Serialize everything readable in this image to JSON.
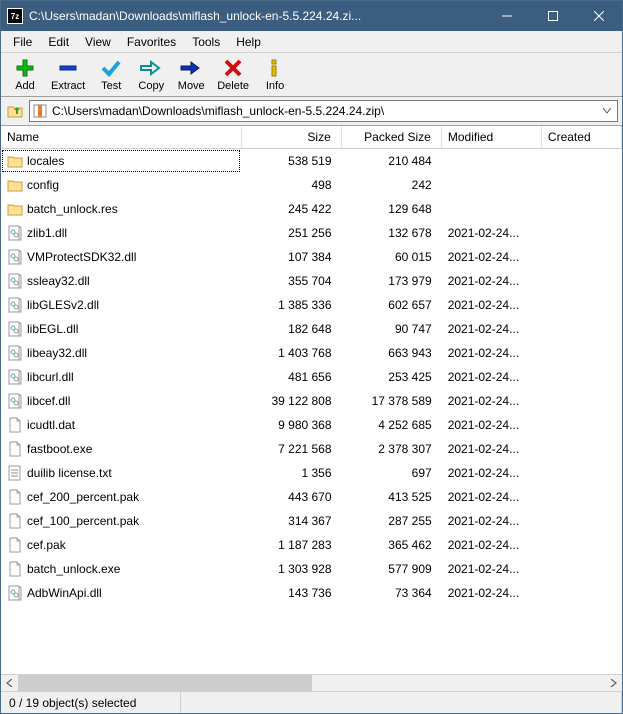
{
  "window": {
    "title": "C:\\Users\\madan\\Downloads\\miflash_unlock-en-5.5.224.24.zi..."
  },
  "menu": {
    "file": "File",
    "edit": "Edit",
    "view": "View",
    "favorites": "Favorites",
    "tools": "Tools",
    "help": "Help"
  },
  "toolbar": {
    "add": "Add",
    "extract": "Extract",
    "test": "Test",
    "copy": "Copy",
    "move": "Move",
    "delete": "Delete",
    "info": "Info"
  },
  "address": {
    "path": "C:\\Users\\madan\\Downloads\\miflash_unlock-en-5.5.224.24.zip\\"
  },
  "columns": {
    "name": "Name",
    "size": "Size",
    "packed": "Packed Size",
    "modified": "Modified",
    "created": "Created"
  },
  "files": [
    {
      "icon": "folder",
      "name": "locales",
      "size": "538 519",
      "packed": "210 484",
      "modified": "",
      "selected": true
    },
    {
      "icon": "folder",
      "name": "config",
      "size": "498",
      "packed": "242",
      "modified": ""
    },
    {
      "icon": "folder",
      "name": "batch_unlock.res",
      "size": "245 422",
      "packed": "129 648",
      "modified": ""
    },
    {
      "icon": "dll",
      "name": "zlib1.dll",
      "size": "251 256",
      "packed": "132 678",
      "modified": "2021-02-24..."
    },
    {
      "icon": "dll",
      "name": "VMProtectSDK32.dll",
      "size": "107 384",
      "packed": "60 015",
      "modified": "2021-02-24..."
    },
    {
      "icon": "dll",
      "name": "ssleay32.dll",
      "size": "355 704",
      "packed": "173 979",
      "modified": "2021-02-24..."
    },
    {
      "icon": "dll",
      "name": "libGLESv2.dll",
      "size": "1 385 336",
      "packed": "602 657",
      "modified": "2021-02-24..."
    },
    {
      "icon": "dll",
      "name": "libEGL.dll",
      "size": "182 648",
      "packed": "90 747",
      "modified": "2021-02-24..."
    },
    {
      "icon": "dll",
      "name": "libeay32.dll",
      "size": "1 403 768",
      "packed": "663 943",
      "modified": "2021-02-24..."
    },
    {
      "icon": "dll",
      "name": "libcurl.dll",
      "size": "481 656",
      "packed": "253 425",
      "modified": "2021-02-24..."
    },
    {
      "icon": "dll",
      "name": "libcef.dll",
      "size": "39 122 808",
      "packed": "17 378 589",
      "modified": "2021-02-24..."
    },
    {
      "icon": "file",
      "name": "icudtl.dat",
      "size": "9 980 368",
      "packed": "4 252 685",
      "modified": "2021-02-24..."
    },
    {
      "icon": "file",
      "name": "fastboot.exe",
      "size": "7 221 568",
      "packed": "2 378 307",
      "modified": "2021-02-24..."
    },
    {
      "icon": "txt",
      "name": "duilib license.txt",
      "size": "1 356",
      "packed": "697",
      "modified": "2021-02-24..."
    },
    {
      "icon": "file",
      "name": "cef_200_percent.pak",
      "size": "443 670",
      "packed": "413 525",
      "modified": "2021-02-24..."
    },
    {
      "icon": "file",
      "name": "cef_100_percent.pak",
      "size": "314 367",
      "packed": "287 255",
      "modified": "2021-02-24..."
    },
    {
      "icon": "file",
      "name": "cef.pak",
      "size": "1 187 283",
      "packed": "365 462",
      "modified": "2021-02-24..."
    },
    {
      "icon": "file",
      "name": "batch_unlock.exe",
      "size": "1 303 928",
      "packed": "577 909",
      "modified": "2021-02-24..."
    },
    {
      "icon": "dll",
      "name": "AdbWinApi.dll",
      "size": "143 736",
      "packed": "73 364",
      "modified": "2021-02-24..."
    }
  ],
  "status": {
    "selection": "0 / 19 object(s) selected"
  }
}
